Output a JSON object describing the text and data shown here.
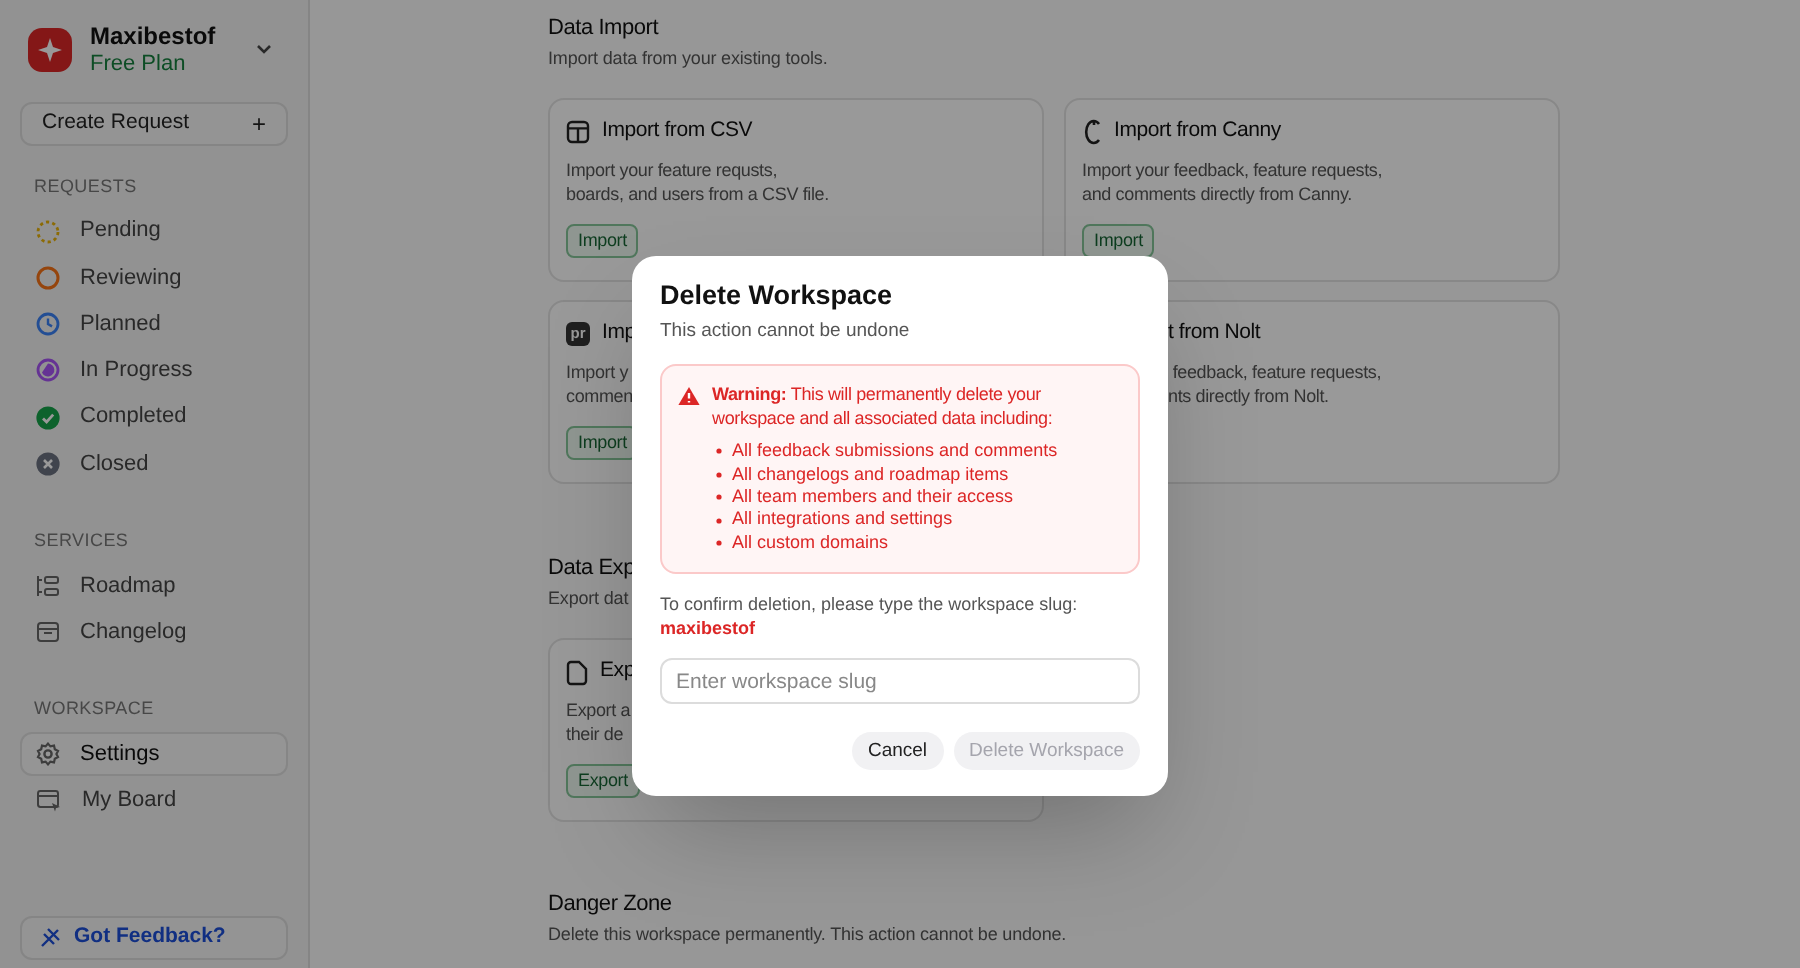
{
  "sidebar": {
    "workspace": {
      "name": "Maxibestof",
      "plan": "Free Plan"
    },
    "create_button": "Create Request",
    "create_icon": "+",
    "sections": [
      {
        "title": "REQUESTS",
        "items": [
          {
            "label": "Pending",
            "kind": "pending",
            "color": "#8c6b05",
            "selected": false
          },
          {
            "label": "Reviewing",
            "kind": "reviewing",
            "color": "#95450d",
            "selected": false
          },
          {
            "label": "Planned",
            "kind": "planned",
            "color": "#234e94",
            "selected": false
          },
          {
            "label": "In Progress",
            "kind": "progress",
            "color": "#653394",
            "selected": false
          },
          {
            "label": "Completed",
            "kind": "completed",
            "color": "#0d622c",
            "selected": false
          },
          {
            "label": "Closed",
            "kind": "closed",
            "color": "#40444d",
            "selected": false
          }
        ]
      },
      {
        "title": "SERVICES",
        "items": [
          {
            "label": "Roadmap",
            "kind": "roadmap",
            "selected": false
          },
          {
            "label": "Changelog",
            "kind": "changelog",
            "selected": false
          }
        ]
      },
      {
        "title": "WORKSPACE",
        "items": [
          {
            "label": "Settings",
            "kind": "settings",
            "selected": true
          },
          {
            "label": "My Board",
            "kind": "board",
            "selected": false
          }
        ]
      }
    ],
    "feedback_button": "Got Feedback?"
  },
  "main": {
    "sections": [
      {
        "title": "Data Import",
        "subtitle": "Import data from your existing tools.",
        "cards": [
          {
            "kind": "table",
            "title": "Import from CSV",
            "description": [
              "Import your feature requsts,",
              "boards, and users from a CSV file."
            ],
            "button": "Import"
          },
          {
            "kind": "canny",
            "title": "Import from Canny",
            "description": [
              "Import your feedback, feature requests,",
              "and comments directly from Canny."
            ],
            "button": "Import"
          },
          {
            "kind": "badge",
            "icon_text": "pr",
            "title": "Imp",
            "description": [
              "Import y",
              "commen"
            ],
            "button": "Import"
          },
          {
            "kind": "covered",
            "title": "t from Nolt",
            "description": [
              " feedback, feature requests,",
              "nts directly from Nolt."
            ]
          }
        ]
      },
      {
        "title": "Data Exp",
        "subtitle": "Export dat",
        "cards": [
          {
            "kind": "file",
            "title": "Exp",
            "description": [
              "Export a",
              "their de"
            ],
            "button": "Export"
          }
        ]
      },
      {
        "title": "Danger Zone",
        "subtitle": "Delete this workspace permanently. This action cannot be undone."
      }
    ]
  },
  "dialog": {
    "title": "Delete Workspace",
    "subtitle": "This action cannot be undone",
    "warning": "**Warning:** This will permanently delete your workspace and all associated data including:",
    "items": [
      "All feedback submissions and comments",
      "All changelogs and roadmap items",
      "All team members and their access",
      "All integrations and settings",
      "All custom domains"
    ],
    "confirm_text": "To confirm deletion, please type the workspace slug:",
    "slug": "maxibestof",
    "input": {
      "placeholder": "Enter workspace slug"
    },
    "buttons": [
      {
        "label": "Cancel",
        "kind": "secondary",
        "disabled": false
      },
      {
        "label": "Delete Workspace",
        "kind": "danger",
        "disabled": true
      }
    ]
  }
}
